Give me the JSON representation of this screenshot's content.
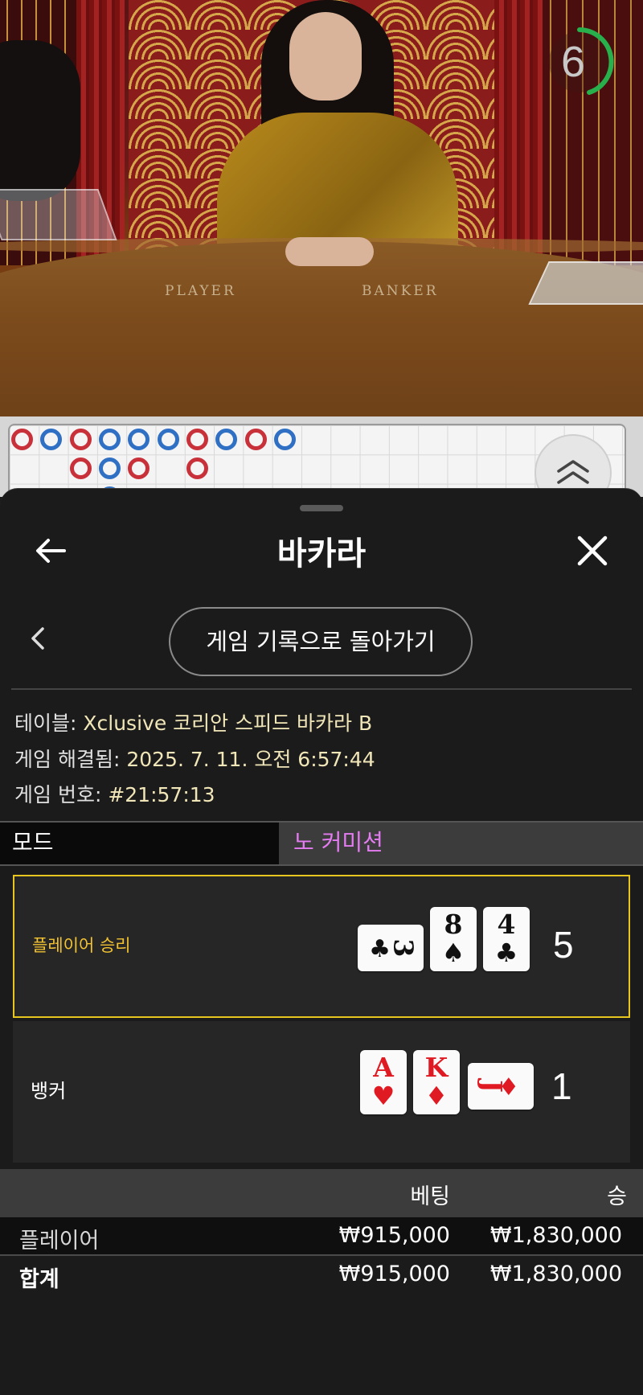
{
  "video": {
    "timer_value": "6",
    "table_labels": {
      "player": "PLAYER",
      "banker": "BANKER"
    }
  },
  "bead_road": {
    "toggle_icon": "double-chevron-up-icon",
    "colors": {
      "player": "#2f6fc4",
      "banker": "#c8313a"
    }
  },
  "sheet": {
    "title": "바카라",
    "back_icon": "arrow-left-icon",
    "close_icon": "close-icon",
    "return_button": "게임 기록으로 돌아가기",
    "prev_icon": "chevron-left-icon"
  },
  "info": {
    "table_label": "테이블:",
    "table_value": "Xclusive 코리안 스피드 바카라 B",
    "resolved_label": "게임 해결됨:",
    "resolved_value": "2025. 7. 11. 오전 6:57:44",
    "number_label": "게임 번호:",
    "number_value": "#21:57:13"
  },
  "mode": {
    "label": "모드",
    "value": "노 커미션",
    "value_color": "#e37cf1"
  },
  "hands": {
    "player": {
      "label": "플레이어 승리",
      "score": "5",
      "cards": [
        {
          "rank": "3",
          "suit": "♣",
          "color": "black",
          "orientation": "horizontal"
        },
        {
          "rank": "8",
          "suit": "♠",
          "color": "black",
          "orientation": "vertical"
        },
        {
          "rank": "4",
          "suit": "♣",
          "color": "black",
          "orientation": "vertical"
        }
      ]
    },
    "banker": {
      "label": "뱅커",
      "score": "1",
      "cards": [
        {
          "rank": "A",
          "suit": "♥",
          "color": "red",
          "orientation": "vertical"
        },
        {
          "rank": "K",
          "suit": "♦",
          "color": "red",
          "orientation": "vertical"
        },
        {
          "rank": "J",
          "suit": "♦",
          "color": "red",
          "orientation": "horizontal"
        }
      ]
    }
  },
  "bets": {
    "header_bet": "베팅",
    "header_win": "승",
    "rows": [
      {
        "label": "플레이어",
        "bet": "₩915,000",
        "win": "₩1,830,000"
      },
      {
        "label": "합계",
        "bet": "₩915,000",
        "win": "₩1,830,000"
      }
    ]
  }
}
